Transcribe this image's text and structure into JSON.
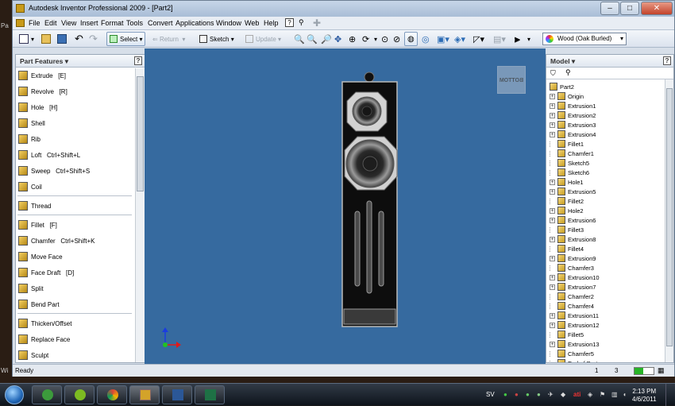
{
  "desktop": {
    "side_label_top": "Pa",
    "side_label_bottom": "Wi"
  },
  "window": {
    "title": "Autodesk Inventor Professional 2009 - [Part2]",
    "controls": [
      "–",
      "□",
      "✕"
    ]
  },
  "menu": [
    "File",
    "Edit",
    "View",
    "Insert",
    "Format",
    "Tools",
    "Convert",
    "Applications",
    "Window",
    "Web",
    "Help"
  ],
  "toolbar": {
    "select_label": "Select",
    "return_label": "Return",
    "sketch_label": "Sketch",
    "update_label": "Update",
    "material": "Wood (Oak Burled)"
  },
  "left_panel": {
    "title": "Part Features ▾",
    "help": "?",
    "features": [
      {
        "label": "Extrude",
        "shortcut": "[E]"
      },
      {
        "label": "Revolve",
        "shortcut": "[R]"
      },
      {
        "label": "Hole",
        "shortcut": "[H]"
      },
      {
        "label": "Shell",
        "shortcut": ""
      },
      {
        "label": "Rib",
        "shortcut": ""
      },
      {
        "label": "Loft",
        "shortcut": "Ctrl+Shift+L"
      },
      {
        "label": "Sweep",
        "shortcut": "Ctrl+Shift+S"
      },
      {
        "label": "Coil",
        "shortcut": ""
      },
      {
        "label": "Thread",
        "shortcut": ""
      },
      {
        "label": "Fillet",
        "shortcut": "[F]"
      },
      {
        "label": "Chamfer",
        "shortcut": "Ctrl+Shift+K"
      },
      {
        "label": "Move Face",
        "shortcut": ""
      },
      {
        "label": "Face Draft",
        "shortcut": "[D]"
      },
      {
        "label": "Split",
        "shortcut": ""
      },
      {
        "label": "Bend Part",
        "shortcut": ""
      },
      {
        "label": "Thicken/Offset",
        "shortcut": ""
      },
      {
        "label": "Replace Face",
        "shortcut": ""
      },
      {
        "label": "Sculpt",
        "shortcut": ""
      }
    ]
  },
  "viewport": {
    "viewcube_label": "BOTTOM"
  },
  "right_panel": {
    "title": "Model ▾",
    "help": "?",
    "root": "Part2",
    "nodes": [
      {
        "label": "Origin",
        "expand": true
      },
      {
        "label": "Extrusion1",
        "expand": true
      },
      {
        "label": "Extrusion2",
        "expand": true
      },
      {
        "label": "Extrusion3",
        "expand": true
      },
      {
        "label": "Extrusion4",
        "expand": true
      },
      {
        "label": "Fillet1",
        "expand": false
      },
      {
        "label": "Chamfer1",
        "expand": false
      },
      {
        "label": "Sketch5",
        "expand": false
      },
      {
        "label": "Sketch6",
        "expand": false
      },
      {
        "label": "Hole1",
        "expand": true
      },
      {
        "label": "Extrusion5",
        "expand": true
      },
      {
        "label": "Fillet2",
        "expand": false
      },
      {
        "label": "Hole2",
        "expand": true
      },
      {
        "label": "Extrusion6",
        "expand": true
      },
      {
        "label": "Fillet3",
        "expand": false
      },
      {
        "label": "Extrusion8",
        "expand": true
      },
      {
        "label": "Fillet4",
        "expand": false
      },
      {
        "label": "Extrusion9",
        "expand": true
      },
      {
        "label": "Chamfer3",
        "expand": false
      },
      {
        "label": "Extrusion10",
        "expand": true
      },
      {
        "label": "Extrusion7",
        "expand": true
      },
      {
        "label": "Chamfer2",
        "expand": false
      },
      {
        "label": "Chamfer4",
        "expand": false
      },
      {
        "label": "Extrusion11",
        "expand": true
      },
      {
        "label": "Extrusion12",
        "expand": true
      },
      {
        "label": "Fillet5",
        "expand": false
      },
      {
        "label": "Extrusion13",
        "expand": true
      },
      {
        "label": "Chamfer5",
        "expand": false
      },
      {
        "label": "End of Part",
        "expand": false
      }
    ]
  },
  "status": {
    "text": "Ready",
    "num1": "1",
    "num2": "3"
  },
  "taskbar": {
    "tray_lang": "SV",
    "time": "2:13 PM",
    "date": "4/6/2011"
  }
}
